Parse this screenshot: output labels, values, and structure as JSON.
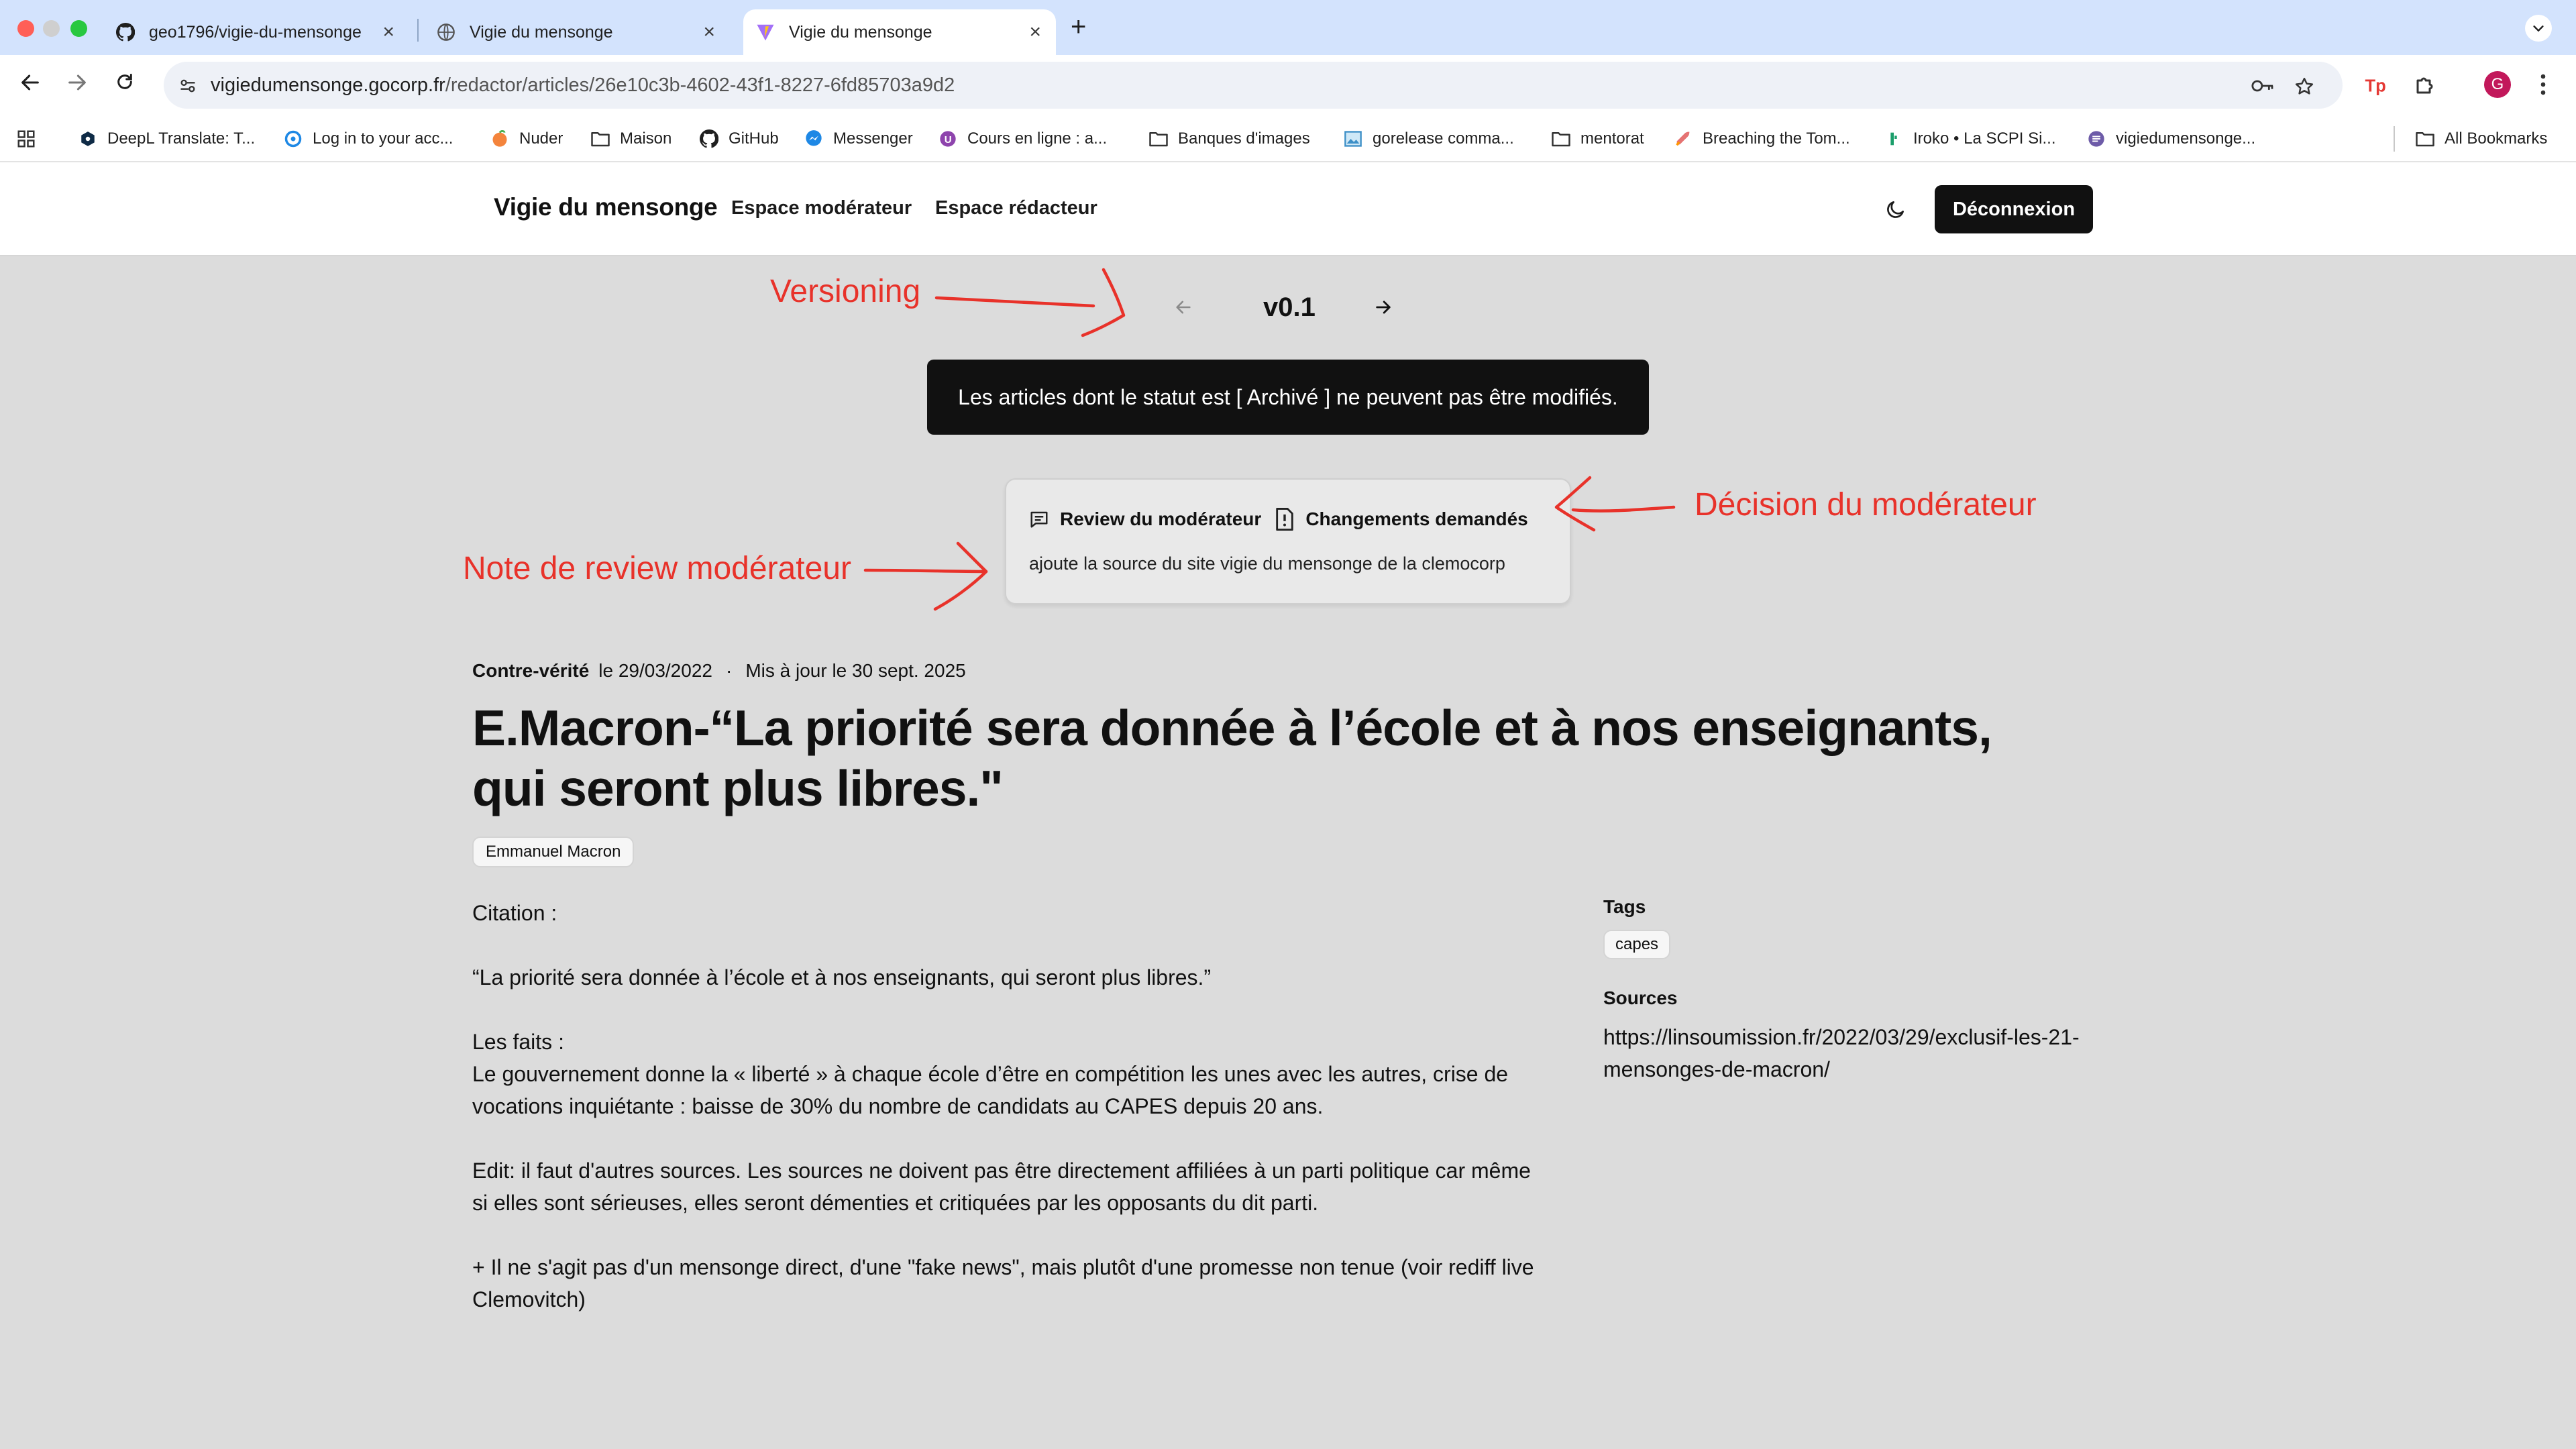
{
  "browser": {
    "tabs": [
      {
        "title": "geo1796/vigie-du-mensonge",
        "icon": "github-icon"
      },
      {
        "title": "Vigie du mensonge",
        "icon": "globe-icon"
      },
      {
        "title": "Vigie du mensonge",
        "icon": "vite-icon",
        "active": true
      }
    ],
    "url_host": "vigiedumensonge.gocorp.fr",
    "url_path": "/redactor/articles/26e10c3b-4602-43f1-8227-6fd85703a9d2",
    "profile_initial": "G",
    "bookmarks": [
      {
        "label": "DeepL Translate: T...",
        "icon": "deepl-icon"
      },
      {
        "label": "Log in to your acc...",
        "icon": "login-icon"
      },
      {
        "label": "Nuder",
        "icon": "peach-icon"
      },
      {
        "label": "Maison",
        "icon": "folder-icon"
      },
      {
        "label": "GitHub",
        "icon": "github-icon"
      },
      {
        "label": "Messenger",
        "icon": "messenger-icon"
      },
      {
        "label": "Cours en ligne  : a...",
        "icon": "course-icon"
      },
      {
        "label": "Banques d'images",
        "icon": "folder-icon"
      },
      {
        "label": "gorelease comma...",
        "icon": "image-icon"
      },
      {
        "label": "mentorat",
        "icon": "folder-icon"
      },
      {
        "label": "Breaching the Tom...",
        "icon": "rocket-icon"
      },
      {
        "label": "Iroko • La SCPI Si...",
        "icon": "iroko-icon"
      },
      {
        "label": "vigiedumensonge...",
        "icon": "site-icon"
      }
    ],
    "all_bookmarks_label": "All Bookmarks"
  },
  "app": {
    "brand": "Vigie du mensonge",
    "nav": [
      "Espace modérateur",
      "Espace rédacteur"
    ],
    "logout_label": "Déconnexion"
  },
  "article": {
    "version": "v0.1",
    "archived_notice": "Les articles dont le statut est [ Archivé ] ne peuvent pas être modifiés.",
    "review": {
      "title": "Review du modérateur",
      "decision": "Changements demandés",
      "note": "ajoute la source du site vigie du mensonge de la clemocorp"
    },
    "category": "Contre-vérité",
    "date": "le 29/03/2022",
    "updated": "Mis à jour le 30 sept. 2025",
    "title": "E.Macron-“La priorité sera donnée à l’école et à nos enseignants, qui seront plus libres.\"",
    "politician": "Emmanuel Macron",
    "body": {
      "citation_label": "Citation :",
      "citation": "“La priorité sera donnée à l’école et à nos enseignants, qui seront plus libres.”",
      "facts_label": "Les faits :",
      "facts": "Le gouvernement donne la « liberté » à chaque école d’être en compétition les unes avec les autres, crise de vocations inquiétante : baisse de 30% du nombre de candidats au CAPES depuis 20 ans.",
      "edit": "Edit: il faut d'autres sources. Les sources ne doivent pas être directement affiliées à un parti politique car même si elles sont sérieuses, elles seront démenties et critiquées par les opposants du dit parti.",
      "addendum": "+ Il ne s'agit pas d'un mensonge direct, d'une \"fake news\", mais plutôt d'une promesse non tenue (voir rediff live Clemovitch)"
    },
    "tags_label": "Tags",
    "tags": [
      "capes"
    ],
    "sources_label": "Sources",
    "sources": [
      "https://linsoumission.fr/2022/03/29/exclusif-les-21-mensonges-de-macron/"
    ]
  },
  "annotations": {
    "versioning": "Versioning",
    "decision": "Décision du modérateur",
    "note": "Note de review modérateur",
    "color": "#e8322a"
  }
}
